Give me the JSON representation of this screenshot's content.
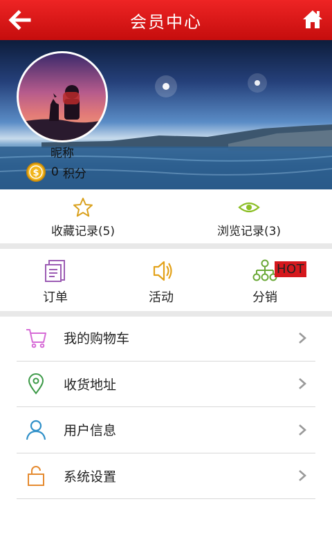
{
  "header": {
    "title": "会员中心",
    "back_icon": "back-arrow-icon",
    "home_icon": "home-icon"
  },
  "profile": {
    "nickname": "昵称",
    "points_value": "0",
    "points_label": "积分",
    "coin_icon": "coin-icon"
  },
  "records": [
    {
      "label": "收藏记录(5)",
      "icon": "star-icon",
      "color": "#d9a01c"
    },
    {
      "label": "浏览记录(3)",
      "icon": "eye-icon",
      "color": "#8cbf26"
    }
  ],
  "menu": [
    {
      "label": "订单",
      "icon": "order-icon",
      "color": "#9b5bb3"
    },
    {
      "label": "活动",
      "icon": "speaker-icon",
      "color": "#e3a21a"
    },
    {
      "label": "分销",
      "icon": "distribution-icon",
      "color": "#6aa836",
      "badge": "HOT"
    }
  ],
  "list": [
    {
      "label": "我的购物车",
      "icon": "cart-icon",
      "color": "#d66bd6"
    },
    {
      "label": "收货地址",
      "icon": "location-pin-icon",
      "color": "#3d9a48"
    },
    {
      "label": "用户信息",
      "icon": "user-icon",
      "color": "#2e8fc8"
    },
    {
      "label": "系统设置",
      "icon": "lock-icon",
      "color": "#e58a2f"
    }
  ],
  "colors": {
    "header": "#d91717",
    "separator": "#e8e8e8",
    "chevron": "#999999"
  }
}
